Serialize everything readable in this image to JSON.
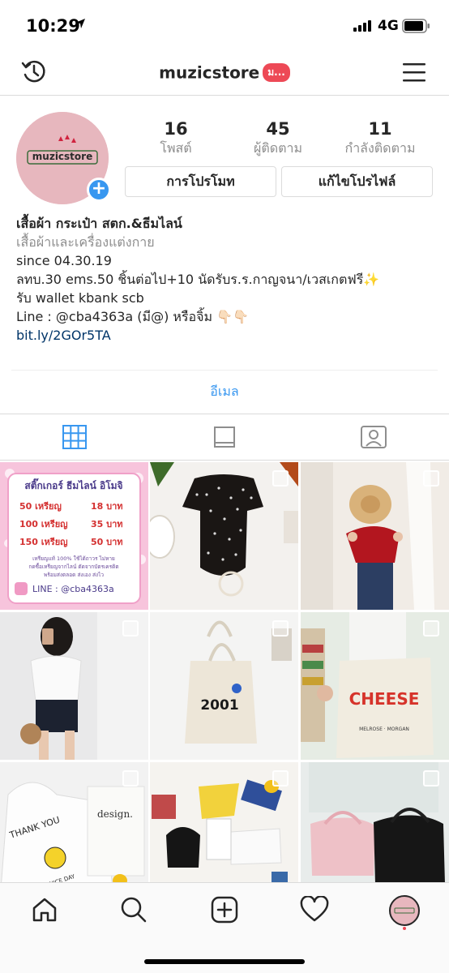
{
  "status_bar": {
    "time": "10:29",
    "network": "4G"
  },
  "header": {
    "username": "muzicstore",
    "badge": "ม..."
  },
  "profile": {
    "avatar_text": "muzicstore",
    "stats": [
      {
        "value": "16",
        "label": "โพสต์"
      },
      {
        "value": "45",
        "label": "ผู้ติดตาม"
      },
      {
        "value": "11",
        "label": "กำลังติดตาม"
      }
    ],
    "buttons": {
      "promote": "การโปรโมท",
      "edit": "แก้ไขโปรไฟล์"
    }
  },
  "bio": {
    "name": "เสื้อผ้า กระเป๋า สตก.&ธีมไลน์",
    "category": "เสื้อผ้าและเครื่องแต่งกาย",
    "lines": [
      "since 04.30.19",
      "ลทบ.30 ems.50 ชิ้นต่อไป+10 นัดรับร.ร.กาญจนา/เวสเกตฟรี✨",
      "รับ wallet kbank scb",
      "Line : @cba4363a (มี@) หรือจิ้ม 👇🏻👇🏻"
    ],
    "link": "bit.ly/2GOr5TA"
  },
  "email_button": "อีเมล",
  "tabs": [
    "grid-icon",
    "igtv-icon",
    "tagged-icon"
  ],
  "sticker_post": {
    "title": "สติ๊กเกอร์ ธีมไลน์ อิโมจิ",
    "rows": [
      {
        "coins": "50 เหรียญ",
        "price": "18 บาท"
      },
      {
        "coins": "100 เหรียญ",
        "price": "35 บาท"
      },
      {
        "coins": "150 เหรียญ",
        "price": "50 บาท"
      }
    ],
    "note1": "เหรียญแท้ 100% ใช้ได้ถาวร ไม่หาย",
    "note2": "กดซื้อเหรียญจากไลน์ ตัดจากบัตรเครดิต",
    "note3": "พร้อมส่งตลอด ส่งเอง ส่งไว",
    "line_id": "LINE : @cba4363a"
  },
  "post_texts": {
    "bag_2001": "2001",
    "cheese": "CHEESE",
    "cheese_sub": "MELROSE · MORGAN",
    "thank_you": "THANK YOU",
    "nice_day": "HAVE A NICE DAY",
    "design": "design."
  },
  "colors": {
    "accent": "#3897f0",
    "badge": "#ed4956",
    "sticker_bg": "#f7c4dc"
  }
}
